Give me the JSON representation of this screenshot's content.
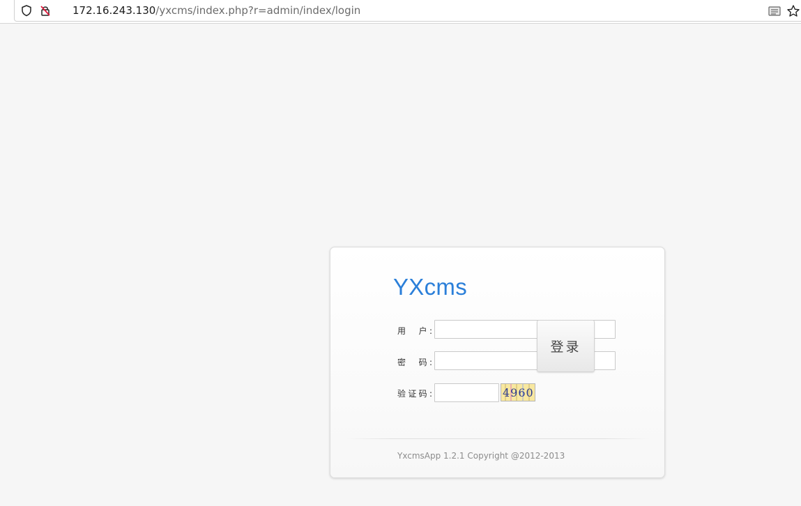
{
  "address_bar": {
    "host": "172.16.243.130",
    "path": "/yxcms/index.php?r=admin/index/login"
  },
  "login": {
    "logo": "YXcms",
    "username_label": "用　户:",
    "password_label": "密　码:",
    "captcha_label": "验证码:",
    "username_value": "",
    "password_value": "",
    "captcha_value": "",
    "captcha_image_text": "4960",
    "submit_label": "登录",
    "copyright": "YxcmsApp 1.2.1 Copyright @2012-2013"
  },
  "colors": {
    "page_background": "#f6f6f6",
    "logo": "#2b7fd9",
    "captcha_background": "#f8e8a0"
  },
  "icons": [
    "shield-icon",
    "insecure-lock-icon",
    "reader-view-icon",
    "bookmark-star-icon"
  ]
}
